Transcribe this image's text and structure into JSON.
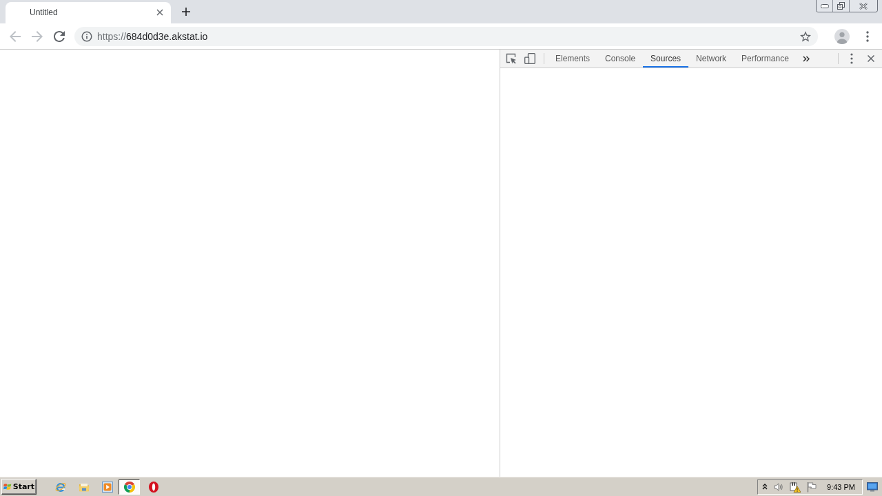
{
  "browser": {
    "tabs": [
      {
        "title": "Untitled",
        "selected": true
      }
    ],
    "nav_buttons": [
      {
        "kind": "back",
        "disabled": true
      },
      {
        "kind": "forward",
        "disabled": true
      },
      {
        "kind": "reload",
        "disabled": false
      }
    ],
    "address_bar": {
      "scheme": "https://",
      "host": "684d0d3e.akstat.io"
    }
  },
  "devtools": {
    "tabs": [
      {
        "label": "Elements",
        "selected": false
      },
      {
        "label": "Console",
        "selected": false
      },
      {
        "label": "Sources",
        "selected": true
      },
      {
        "label": "Network",
        "selected": false
      },
      {
        "label": "Performance",
        "selected": false
      }
    ]
  },
  "taskbar": {
    "start_label": "Start",
    "apps": [
      {
        "kind": "letter-e",
        "selected": false
      },
      {
        "kind": "folder",
        "selected": false
      },
      {
        "kind": "play",
        "selected": false
      },
      {
        "kind": "wheel",
        "selected": true
      },
      {
        "kind": "oval",
        "selected": false
      }
    ],
    "clock": "9:43 PM"
  }
}
